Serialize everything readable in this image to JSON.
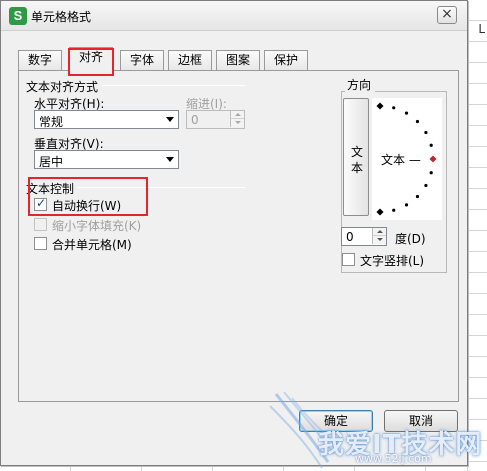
{
  "window": {
    "app_icon_letter": "S",
    "title": "单元格格式",
    "close_glyph": "×"
  },
  "background": {
    "column_label": "L"
  },
  "tabs": [
    {
      "label": "数字",
      "active": false
    },
    {
      "label": "对齐",
      "active": true
    },
    {
      "label": "字体",
      "active": false
    },
    {
      "label": "边框",
      "active": false
    },
    {
      "label": "图案",
      "active": false
    },
    {
      "label": "保护",
      "active": false
    }
  ],
  "text_alignment": {
    "group_title": "文本对齐方式",
    "horizontal_label": "水平对齐(H):",
    "horizontal_value": "常规",
    "indent_label": "缩进(I):",
    "indent_value": "0",
    "vertical_label": "垂直对齐(V):",
    "vertical_value": "居中"
  },
  "text_control": {
    "group_title": "文本控制",
    "wrap_text_label": "自动换行(W)",
    "wrap_text_checked": true,
    "shrink_to_fit_label": "缩小字体填充(K)",
    "shrink_to_fit_checked": false,
    "merge_cells_label": "合并单元格(M)",
    "merge_cells_checked": false
  },
  "orientation": {
    "group_title": "方向",
    "vertical_text_char_1": "文",
    "vertical_text_char_2": "本",
    "dial_text": "文本 —",
    "degrees_value": "0",
    "degrees_label": "度(D)",
    "vertical_stack_label": "文字竖排(L)",
    "vertical_stack_checked": false,
    "marker_color": "#c0282d"
  },
  "footer": {
    "ok_label": "确定",
    "cancel_label": "取消"
  },
  "watermark": {
    "text": "我爱IT技术网",
    "url": "www.52ij.com"
  },
  "colors": {
    "highlight": "#e8232b",
    "app_icon": "#2f9a46"
  }
}
